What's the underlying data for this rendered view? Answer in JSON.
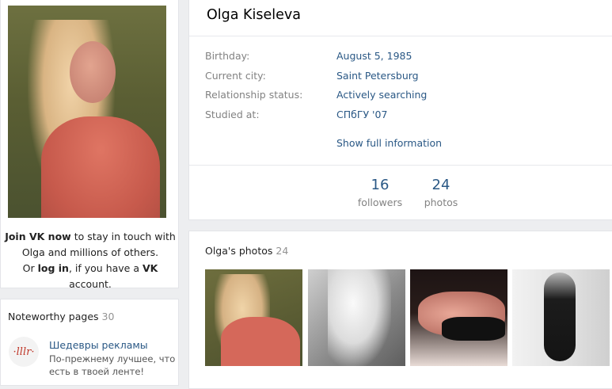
{
  "join": {
    "bold1": "Join VK now",
    "text1": " to stay in touch with Olga and millions of others.",
    "text2": "Or ",
    "bold2": "log in",
    "text3": ", if you have a ",
    "bold3": "VK",
    "text4": " account."
  },
  "noteworthy": {
    "title": "Noteworthy pages",
    "count": "30",
    "item": {
      "logo": "·lllr·",
      "name": "Шедевры рекламы",
      "desc": "По-прежнему лучшее, что есть в твоей ленте!"
    }
  },
  "profile": {
    "name": "Olga Kiseleva",
    "info": [
      {
        "label": "Birthday:",
        "value": "August 5, 1985"
      },
      {
        "label": "Current city:",
        "value": "Saint Petersburg"
      },
      {
        "label": "Relationship status:",
        "value": "Actively searching"
      },
      {
        "label": "Studied at:",
        "value": "СПбГУ '07"
      }
    ],
    "show_full": "Show full information",
    "counters": [
      {
        "num": "16",
        "label": "followers"
      },
      {
        "num": "24",
        "label": "photos"
      }
    ]
  },
  "photos": {
    "title": "Olga's photos",
    "count": "24"
  },
  "colors": {
    "link": "#2a5885",
    "muted": "#828282",
    "background": "#edeef0"
  }
}
